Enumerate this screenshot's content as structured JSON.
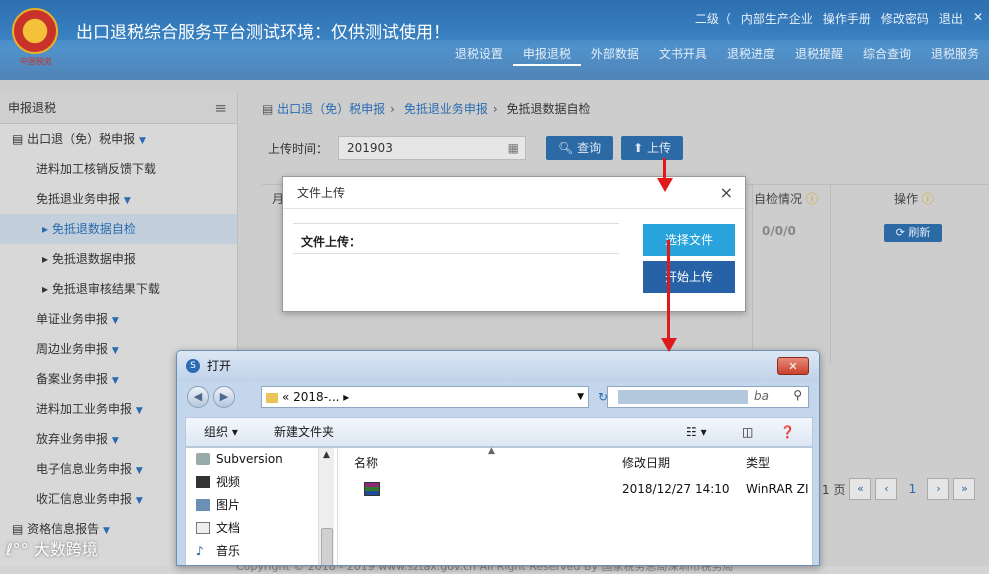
{
  "header": {
    "title": "出口退税综合服务平台测试环境：仅供测试使用！",
    "logo_caption": "中国税务",
    "top_links": [
      "二级（",
      "内部生产企业",
      "操作手册",
      "修改密码",
      "退出"
    ],
    "top_close": "✕",
    "nav": [
      "退税设置",
      "申报退税",
      "外部数据",
      "文书开具",
      "退税进度",
      "退税提醒",
      "综合查询",
      "退税服务"
    ],
    "nav_active_index": 1
  },
  "sidebar": {
    "title": "申报退税",
    "items": [
      {
        "label": "出口退（免）税申报",
        "level": 1,
        "caret": true
      },
      {
        "label": "进料加工核销反馈下载",
        "level": 2
      },
      {
        "label": "免抵退业务申报",
        "level": 2,
        "caret": true
      },
      {
        "label": "免抵退数据自检",
        "level": 3,
        "active": true
      },
      {
        "label": "免抵退数据申报",
        "level": 3
      },
      {
        "label": "免抵退审核结果下载",
        "level": 3
      },
      {
        "label": "单证业务申报",
        "level": 2,
        "caret": true
      },
      {
        "label": "周边业务申报",
        "level": 2,
        "caret": true
      },
      {
        "label": "备案业务申报",
        "level": 2,
        "caret": true
      },
      {
        "label": "进料加工业务申报",
        "level": 2,
        "caret": true
      },
      {
        "label": "放弃业务申报",
        "level": 2,
        "caret": true
      },
      {
        "label": "电子信息业务申报",
        "level": 2,
        "caret": true
      },
      {
        "label": "收汇信息业务申报",
        "level": 2,
        "caret": true
      },
      {
        "label": "资格信息报告",
        "level": 1,
        "caret": true
      }
    ]
  },
  "breadcrumb": [
    "出口退（免）税申报",
    "免抵退业务申报",
    "免抵退数据自检"
  ],
  "query": {
    "label": "上传时间：",
    "value": "201903",
    "query_btn": "查询",
    "upload_btn": "上传"
  },
  "table": {
    "col_first": "月",
    "col_check": "自检情况",
    "col_ops": "操作",
    "check_value": "0/0/0",
    "refresh_btn": "刷新"
  },
  "pager": {
    "text": "1 页",
    "current": "1",
    "first": "«",
    "prev": "‹",
    "next": "›",
    "last": "»"
  },
  "footer": "Copyright © 2018 - 2019 www.sztax.gov.cn All Right Reserved By 国家税务总局深圳市税务局",
  "upload_dialog": {
    "title": "文件上传",
    "close": "×",
    "field_label": "文件上传：",
    "choose_btn": "选择文件",
    "start_btn": "开始上传"
  },
  "open_dialog": {
    "title": "打开",
    "close": "✕",
    "address": "« 2018-...",
    "search_placeholder": "ba",
    "organize": "组织",
    "new_folder": "新建文件夹",
    "tree": [
      "Subversion",
      "视频",
      "图片",
      "文档",
      "音乐"
    ],
    "columns": {
      "name": "名称",
      "date": "修改日期",
      "type": "类型"
    },
    "file": {
      "date": "2018/12/27 14:10",
      "type": "WinRAR ZI"
    }
  },
  "watermark": "大数跨境",
  "colors": {
    "header_blue": "#3d86c6",
    "button_blue": "#2c6aa6",
    "choose_btn": "#29a3db",
    "start_btn": "#2762a6",
    "arrow_red": "#e01a1a"
  }
}
